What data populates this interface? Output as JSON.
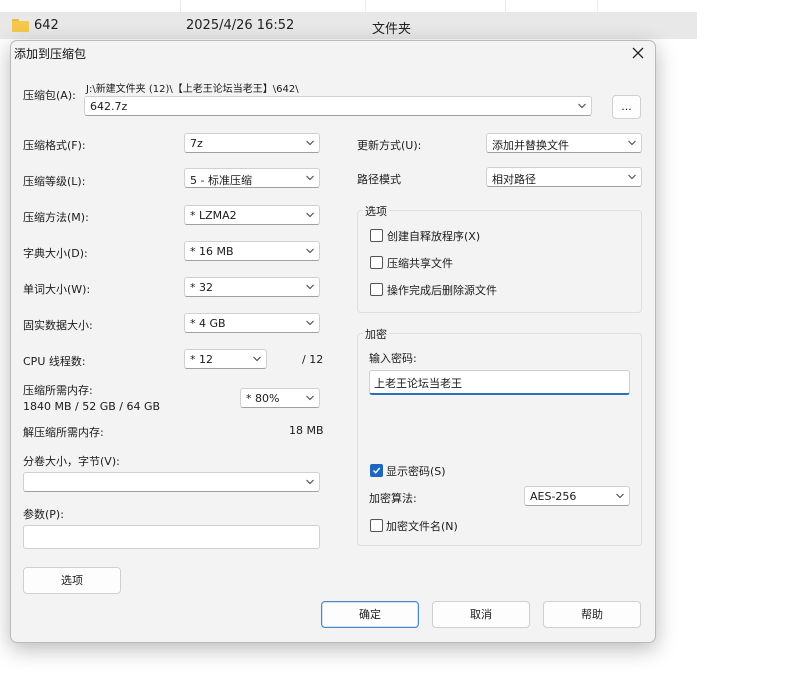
{
  "background_row": {
    "name": "642",
    "date": "2025/4/26 16:52",
    "type": "文件夹"
  },
  "dialog": {
    "title": "添加到压缩包",
    "archive_label": "压缩包(A):",
    "archive_path": "J:\\新建文件夹 (12)\\【上老王论坛当老王】\\642\\",
    "archive_name": "642.7z",
    "browse_label": "...",
    "left": {
      "format_label": "压缩格式(F):",
      "format_value": "7z",
      "level_label": "压缩等级(L):",
      "level_value": "5 - 标准压缩",
      "method_label": "压缩方法(M):",
      "method_value": "* LZMA2",
      "dict_label": "字典大小(D):",
      "dict_value": "* 16 MB",
      "word_label": "单词大小(W):",
      "word_value": "* 32",
      "solid_label": "固实数据大小:",
      "solid_value": "* 4 GB",
      "threads_label": "CPU 线程数:",
      "threads_value": "* 12",
      "threads_max": "/ 12",
      "mem_label": "压缩所需内存:",
      "mem_value": "1840 MB / 52 GB / 64 GB",
      "mem_percent": "* 80%",
      "decomp_label": "解压缩所需内存:",
      "decomp_value": "18 MB",
      "split_label": "分卷大小，字节(V):",
      "split_value": "",
      "params_label": "参数(P):",
      "params_value": "",
      "options_button": "选项"
    },
    "right": {
      "update_label": "更新方式(U):",
      "update_value": "添加并替换文件",
      "path_label": "路径模式",
      "path_value": "相对路径",
      "options_group": "选项",
      "opt_sfx": "创建自释放程序(X)",
      "opt_shared": "压缩共享文件",
      "opt_delete": "操作完成后删除源文件",
      "encrypt_group": "加密",
      "password_label": "输入密码:",
      "password_value": "上老王论坛当老王",
      "show_password": "显示密码(S)",
      "method_label": "加密算法:",
      "method_value": "AES-256",
      "encrypt_names": "加密文件名(N)"
    },
    "buttons": {
      "ok": "确定",
      "cancel": "取消",
      "help": "帮助"
    }
  }
}
